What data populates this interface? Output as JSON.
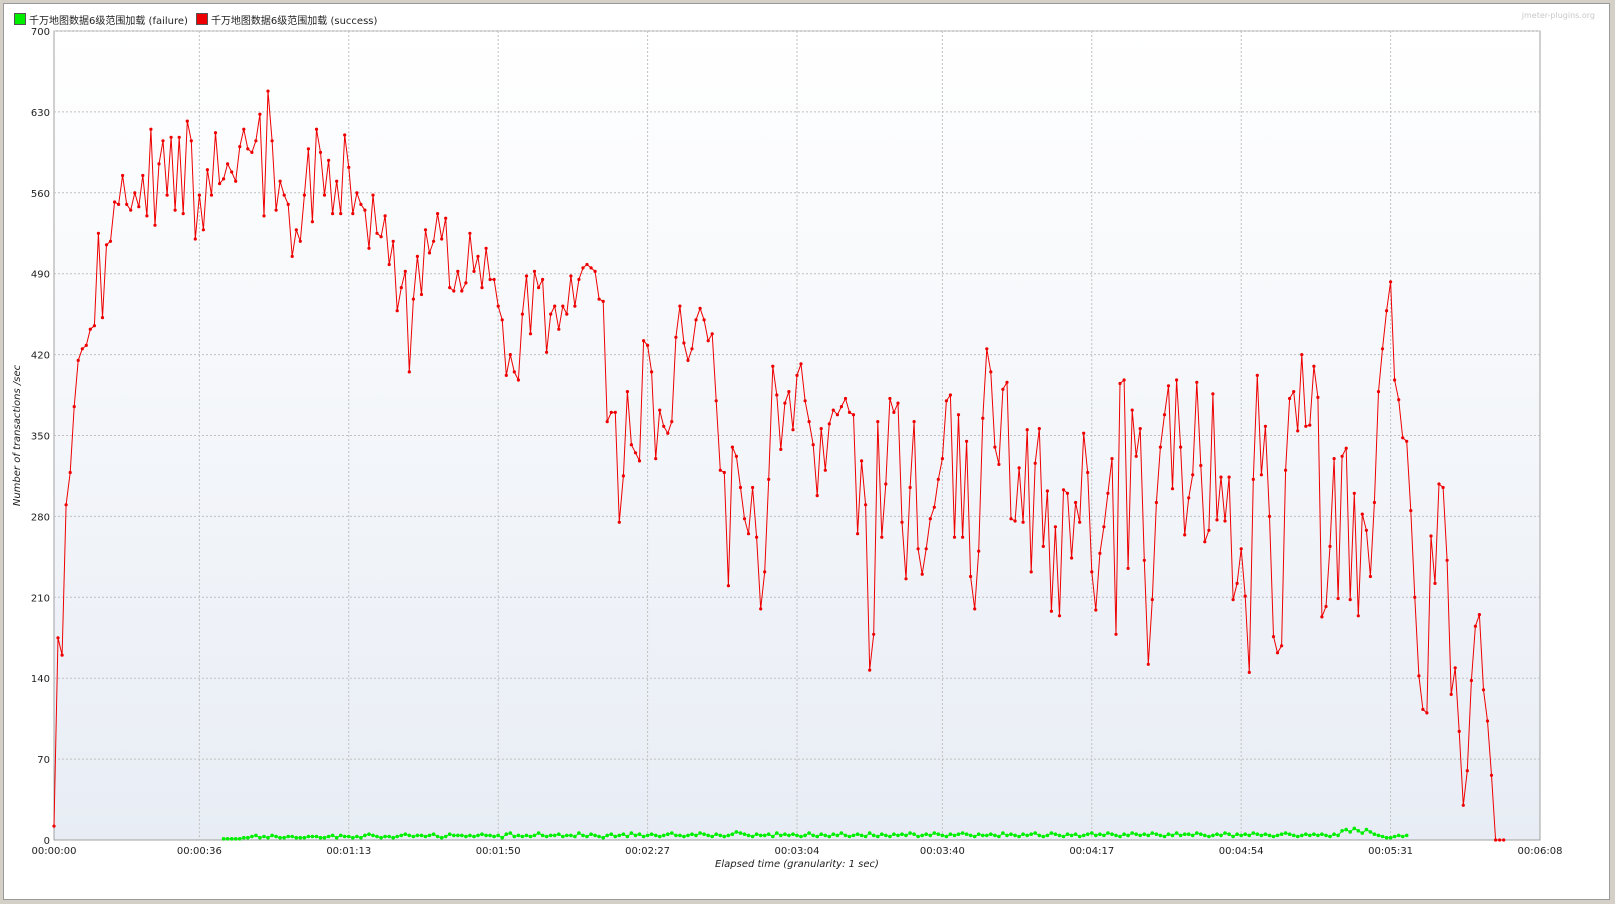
{
  "watermark": "jmeter-plugins.org",
  "legend": [
    {
      "label": "千万地图数据6级范围加载 (failure)",
      "color": "#00ee00"
    },
    {
      "label": "千万地图数据6级范围加载 (success)",
      "color": "#ee0000"
    }
  ],
  "chart_data": {
    "type": "line",
    "title": "",
    "xlabel": "Elapsed time (granularity: 1 sec)",
    "ylabel": "Number of transactions /sec",
    "ylim": [
      0,
      700
    ],
    "yticks": [
      0,
      70,
      140,
      210,
      280,
      350,
      420,
      490,
      560,
      630,
      700
    ],
    "xlim": [
      0,
      368
    ],
    "xticks": [
      {
        "sec": 0,
        "label": "00:00:00"
      },
      {
        "sec": 36,
        "label": "00:00:36"
      },
      {
        "sec": 73,
        "label": "00:01:13"
      },
      {
        "sec": 110,
        "label": "00:01:50"
      },
      {
        "sec": 147,
        "label": "00:02:27"
      },
      {
        "sec": 184,
        "label": "00:03:04"
      },
      {
        "sec": 220,
        "label": "00:03:40"
      },
      {
        "sec": 257,
        "label": "00:04:17"
      },
      {
        "sec": 294,
        "label": "00:04:54"
      },
      {
        "sec": 331,
        "label": "00:05:31"
      },
      {
        "sec": 368,
        "label": "00:06:08"
      }
    ],
    "grid": true,
    "legend_position": "top-left",
    "series": [
      {
        "name": "千万地图数据6级范围加载 (success)",
        "color": "#ee0000",
        "start_sec": 0,
        "values": [
          12,
          175,
          160,
          290,
          318,
          375,
          415,
          425,
          428,
          442,
          445,
          525,
          452,
          515,
          518,
          552,
          550,
          575,
          550,
          545,
          560,
          548,
          575,
          540,
          615,
          532,
          585,
          605,
          558,
          608,
          545,
          608,
          542,
          622,
          605,
          520,
          558,
          528,
          580,
          558,
          612,
          568,
          572,
          585,
          578,
          570,
          600,
          615,
          598,
          595,
          605,
          628,
          540,
          648,
          605,
          545,
          570,
          558,
          550,
          505,
          528,
          518,
          558,
          598,
          535,
          615,
          595,
          558,
          588,
          542,
          570,
          542,
          610,
          582,
          542,
          560,
          550,
          545,
          512,
          558,
          525,
          522,
          540,
          498,
          518,
          458,
          478,
          492,
          405,
          468,
          505,
          472,
          528,
          508,
          518,
          542,
          520,
          538,
          478,
          475,
          492,
          475,
          482,
          525,
          492,
          505,
          478,
          512,
          485,
          485,
          462,
          450,
          402,
          420,
          405,
          398,
          455,
          488,
          438,
          492,
          478,
          485,
          422,
          455,
          462,
          442,
          462,
          455,
          488,
          462,
          485,
          495,
          498,
          495,
          492,
          468,
          466,
          362,
          370,
          370,
          275,
          315,
          388,
          342,
          335,
          328,
          432,
          428,
          405,
          330,
          372,
          358,
          352,
          362,
          435,
          462,
          430,
          415,
          425,
          450,
          460,
          450,
          432,
          438,
          380,
          320,
          318,
          220,
          340,
          332,
          305,
          278,
          265,
          305,
          262,
          200,
          232,
          312,
          410,
          385,
          338,
          378,
          388,
          355,
          402,
          412,
          380,
          362,
          342,
          298,
          356,
          320,
          360,
          372,
          368,
          375,
          382,
          370,
          368,
          265,
          328,
          290,
          147,
          178,
          362,
          262,
          308,
          382,
          370,
          378,
          275,
          226,
          305,
          362,
          252,
          230,
          252,
          278,
          288,
          312,
          330,
          380,
          385,
          262,
          368,
          262,
          345,
          228,
          200,
          250,
          365,
          425,
          405,
          340,
          325,
          390,
          396,
          278,
          276,
          322,
          275,
          355,
          232,
          326,
          356,
          254,
          302,
          198,
          271,
          194,
          303,
          300,
          244,
          292,
          275,
          352,
          318,
          232,
          199,
          248,
          271,
          300,
          330,
          178,
          395,
          398,
          235,
          372,
          332,
          356,
          242,
          152,
          208,
          292,
          340,
          368,
          393,
          304,
          398,
          340,
          264,
          296,
          316,
          396,
          324,
          258,
          268,
          386,
          277,
          314,
          276,
          314,
          208,
          222,
          252,
          211,
          145,
          312,
          402,
          316,
          358,
          280,
          176,
          162,
          168,
          320,
          382,
          388,
          354,
          420,
          358,
          359,
          410,
          383,
          193,
          202,
          254,
          330,
          209,
          332,
          339,
          208,
          300,
          194,
          282,
          268,
          228,
          292,
          388,
          425,
          458,
          483,
          398,
          381,
          348,
          345,
          285,
          210,
          142,
          113,
          110,
          263,
          222,
          308,
          305,
          242,
          126,
          149,
          94,
          30,
          60,
          138,
          185,
          195,
          130,
          103,
          56,
          0,
          0,
          0
        ]
      },
      {
        "name": "千万地图数据6级范围加载 (failure)",
        "color": "#00ee00",
        "start_sec": 42,
        "values": [
          1,
          1,
          1,
          1,
          1,
          2,
          2,
          3,
          4,
          2,
          3,
          2,
          4,
          3,
          2,
          2,
          3,
          3,
          2,
          2,
          2,
          3,
          3,
          3,
          2,
          2,
          3,
          4,
          2,
          4,
          3,
          3,
          2,
          3,
          2,
          4,
          5,
          4,
          3,
          2,
          3,
          3,
          2,
          3,
          4,
          5,
          4,
          3,
          4,
          4,
          3,
          4,
          5,
          3,
          2,
          3,
          5,
          4,
          4,
          4,
          3,
          4,
          3,
          4,
          5,
          4,
          4,
          3,
          4,
          2,
          5,
          6,
          3,
          4,
          3,
          4,
          3,
          4,
          6,
          4,
          3,
          4,
          4,
          5,
          3,
          4,
          4,
          3,
          6,
          4,
          3,
          5,
          4,
          3,
          2,
          4,
          5,
          3,
          4,
          5,
          3,
          6,
          4,
          5,
          3,
          4,
          5,
          4,
          3,
          4,
          5,
          6,
          4,
          4,
          3,
          4,
          5,
          4,
          6,
          5,
          4,
          3,
          5,
          4,
          3,
          4,
          5,
          7,
          6,
          5,
          4,
          3,
          5,
          4,
          4,
          5,
          3,
          6,
          4,
          5,
          4,
          5,
          4,
          3,
          4,
          6,
          4,
          3,
          5,
          4,
          3,
          5,
          4,
          6,
          4,
          3,
          4,
          5,
          4,
          3,
          6,
          4,
          3,
          5,
          4,
          3,
          5,
          4,
          5,
          4,
          6,
          5,
          3,
          4,
          5,
          4,
          6,
          5,
          4,
          3,
          5,
          4,
          5,
          6,
          5,
          4,
          3,
          5,
          4,
          4,
          5,
          4,
          3,
          6,
          4,
          5,
          4,
          3,
          5,
          4,
          5,
          6,
          4,
          3,
          4,
          6,
          5,
          4,
          3,
          5,
          4,
          5,
          3,
          4,
          5,
          6,
          4,
          5,
          4,
          6,
          5,
          4,
          3,
          5,
          4,
          6,
          5,
          4,
          5,
          4,
          6,
          5,
          4,
          3,
          5,
          4,
          6,
          4,
          5,
          5,
          4,
          6,
          5,
          4,
          3,
          4,
          5,
          4,
          6,
          5,
          3,
          5,
          4,
          5,
          4,
          6,
          5,
          4,
          5,
          4,
          3,
          4,
          5,
          6,
          5,
          4,
          3,
          4,
          5,
          4,
          5,
          4,
          5,
          4,
          3,
          5,
          4,
          8,
          9,
          7,
          10,
          8,
          6,
          9,
          7,
          5,
          4,
          3,
          2,
          2,
          3,
          4,
          3,
          4
        ]
      }
    ]
  }
}
